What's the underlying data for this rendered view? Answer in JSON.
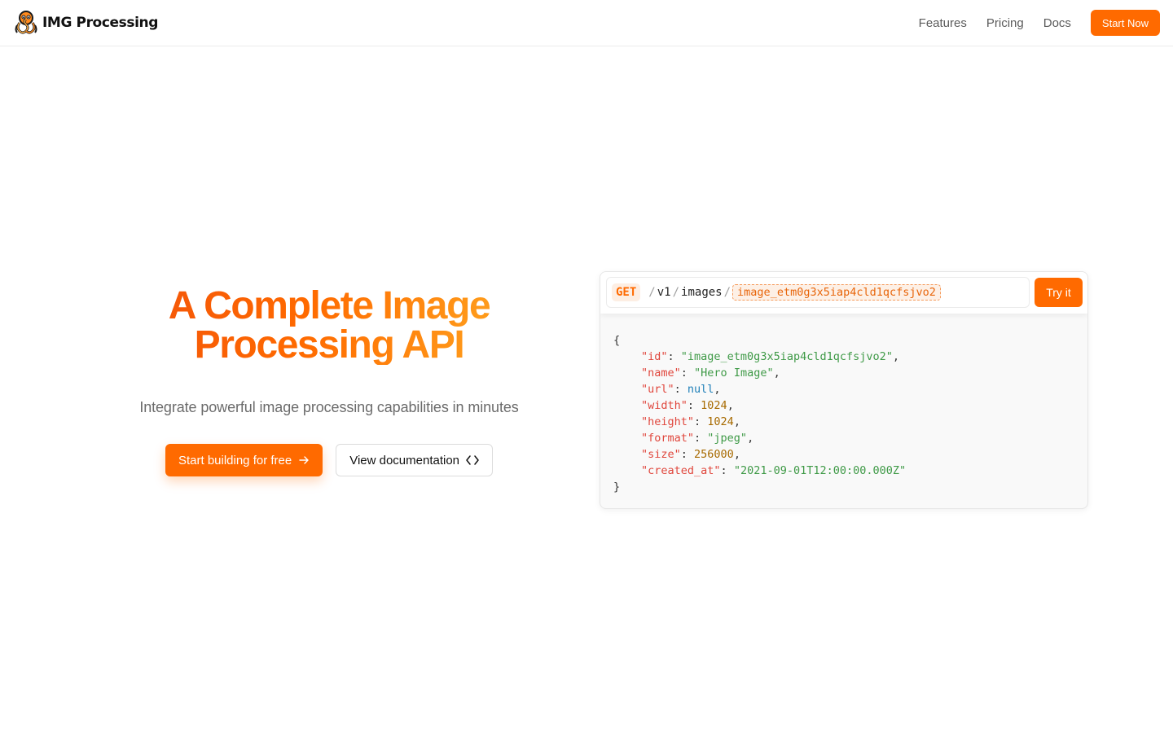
{
  "header": {
    "brand": "IMG Processing",
    "logo_icon": "octopus-logo-icon",
    "nav": [
      {
        "label": "Features"
      },
      {
        "label": "Pricing"
      },
      {
        "label": "Docs"
      }
    ],
    "cta_label": "Start Now"
  },
  "hero": {
    "title_line1": "A Complete Image",
    "title_line2": "Processing API",
    "subtitle": "Integrate powerful image processing capabilities in minutes",
    "primary_label": "Start building for free",
    "primary_icon": "arrow-right-icon",
    "secondary_label": "View documentation",
    "secondary_icon": "code-brackets-icon"
  },
  "api": {
    "method": "GET",
    "separator": "/",
    "segments": [
      "v1",
      "images"
    ],
    "param": "image_etm0g3x5iap4cld1qcfsjvo2",
    "try_label": "Try it",
    "response": {
      "open": "{",
      "close": "}",
      "fields": [
        {
          "key": "\"id\"",
          "value": "\"image_etm0g3x5iap4cld1qcfsjvo2\"",
          "kind": "string"
        },
        {
          "key": "\"name\"",
          "value": "\"Hero Image\"",
          "kind": "string"
        },
        {
          "key": "\"url\"",
          "value": "null",
          "kind": "null"
        },
        {
          "key": "\"width\"",
          "value": "1024",
          "kind": "number"
        },
        {
          "key": "\"height\"",
          "value": "1024",
          "kind": "number"
        },
        {
          "key": "\"format\"",
          "value": "\"jpeg\"",
          "kind": "string"
        },
        {
          "key": "\"size\"",
          "value": "256000",
          "kind": "number"
        },
        {
          "key": "\"created_at\"",
          "value": "\"2021-09-01T12:00:00.000Z\"",
          "kind": "string"
        }
      ]
    }
  },
  "colors": {
    "accent": "#ff6a00",
    "json_key": "#e0463c",
    "json_string": "#3f9a47",
    "json_number": "#a76a00",
    "json_null": "#1e7fb8"
  }
}
